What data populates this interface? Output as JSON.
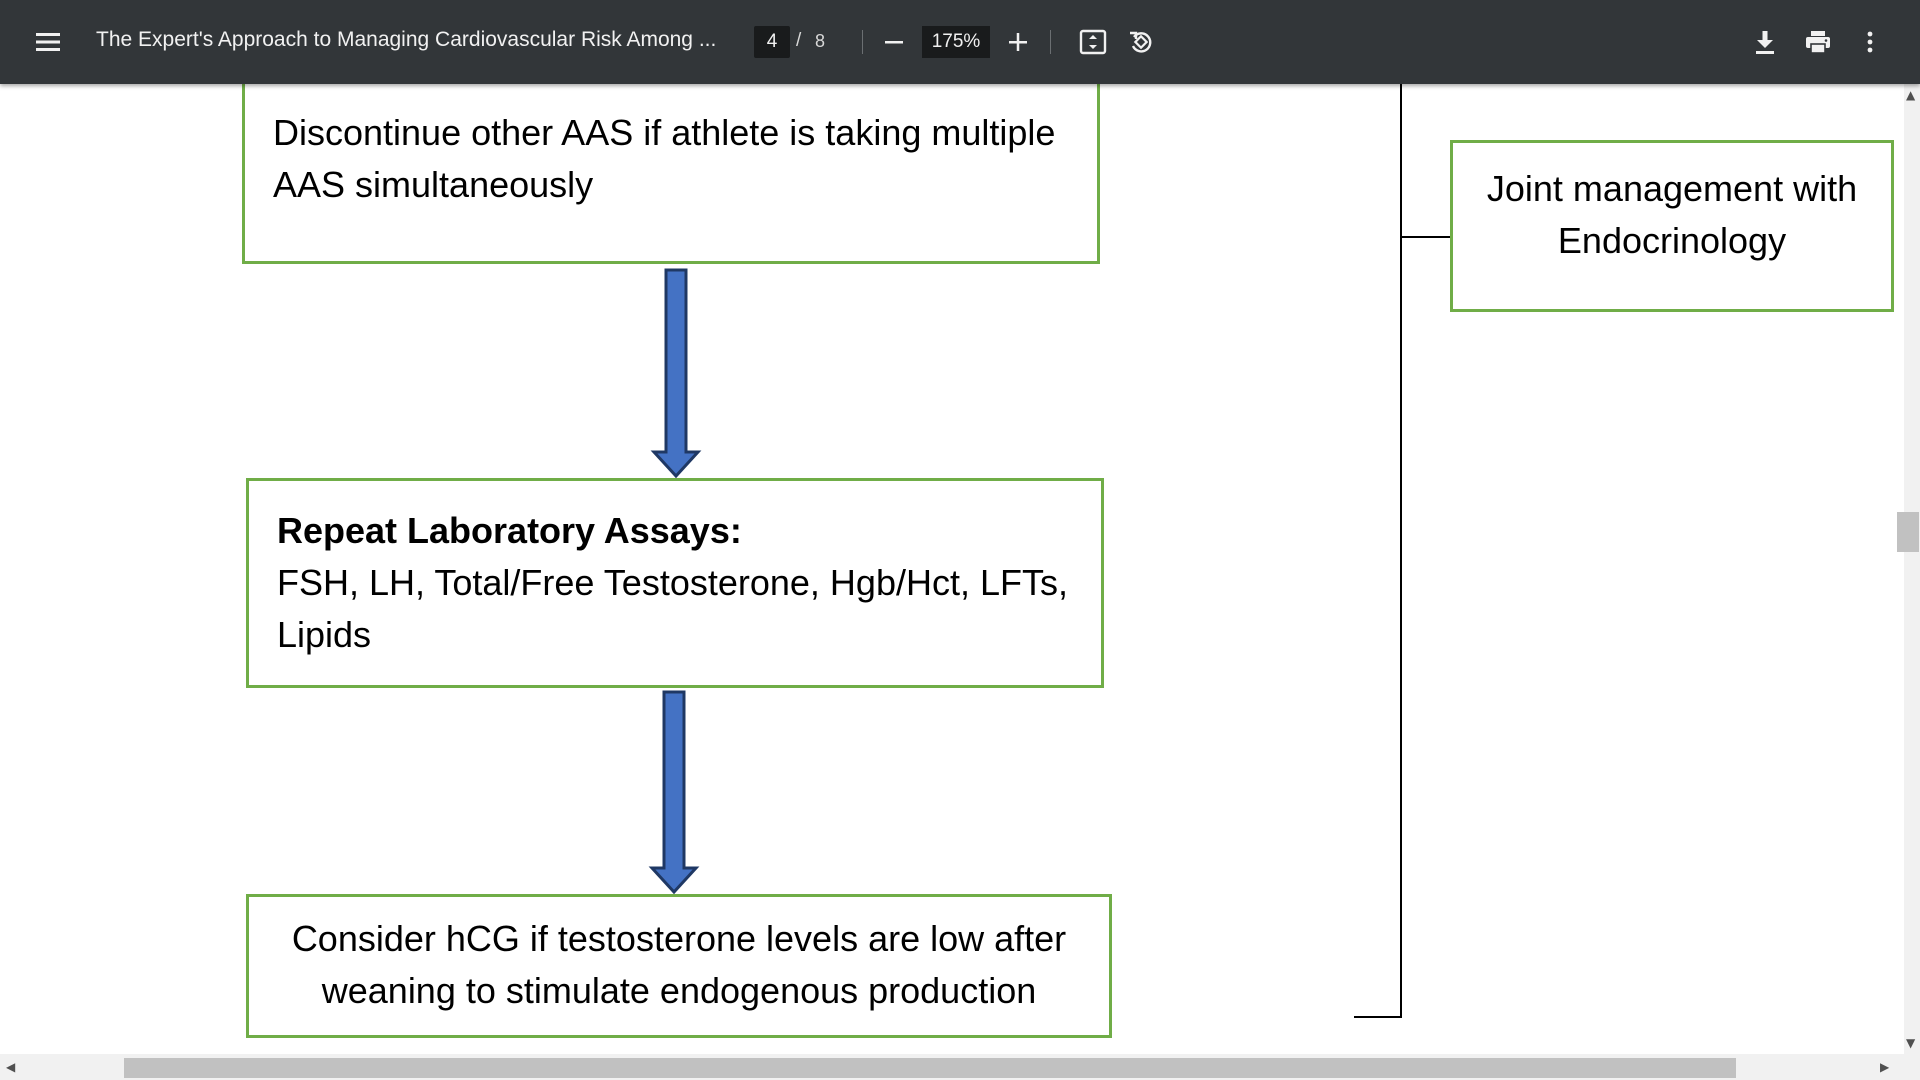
{
  "toolbar": {
    "title": "The Expert's Approach to Managing Cardiovascular Risk Among ...",
    "current_page": "4",
    "page_separator": "/",
    "total_pages": "8",
    "zoom": "175%",
    "icons": {
      "menu": "menu-icon",
      "zoom_out": "minus-icon",
      "zoom_in": "plus-icon",
      "fit": "fit-page-icon",
      "rotate": "rotate-icon",
      "download": "download-icon",
      "print": "print-icon",
      "more": "more-vert-icon"
    }
  },
  "flowchart": {
    "box1": "Discontinue other AAS if athlete is taking multiple AAS simultaneously",
    "box2_heading": "Repeat Laboratory Assays:",
    "box2_body": " FSH, LH, Total/Free Testosterone, Hgb/Hct, LFTs, Lipids",
    "box3": "Consider hCG if testosterone levels are low after weaning to stimulate endogenous production",
    "side_box": "Joint management with Endocrinology"
  },
  "colors": {
    "toolbar_bg": "#323639",
    "box_border": "#70ad47",
    "arrow_fill": "#4472c4",
    "arrow_stroke": "#1f3864"
  }
}
